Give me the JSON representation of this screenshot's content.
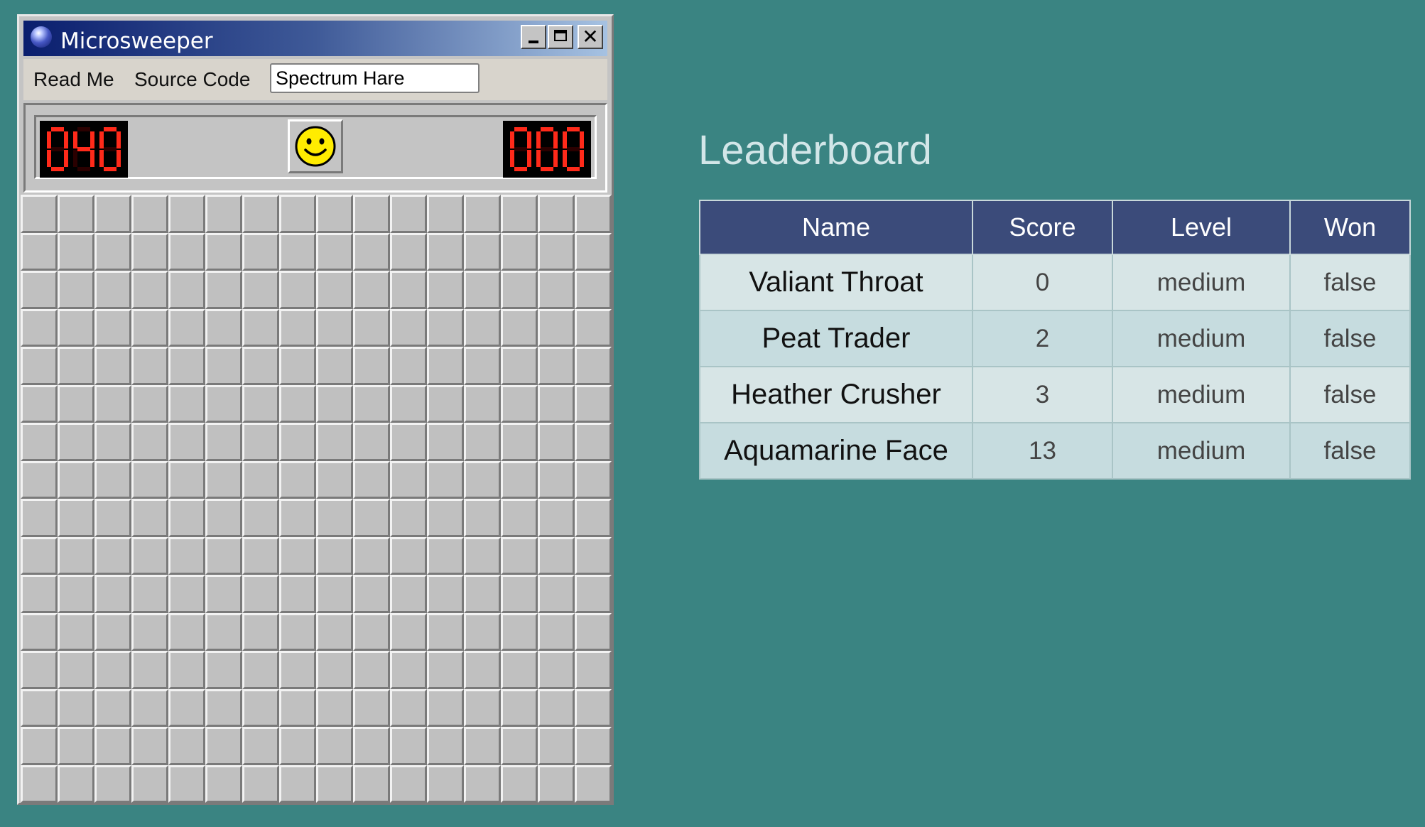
{
  "window": {
    "title": "Microsweeper",
    "controls": [
      "minimize",
      "maximize",
      "close"
    ]
  },
  "menu": {
    "read_me": "Read Me",
    "source_code": "Source Code",
    "player_name_value": "Spectrum Hare"
  },
  "game": {
    "mines_remaining": "040",
    "timer": "000",
    "face_state": "smile",
    "rows": 16,
    "cols": 16,
    "cell_state": "unrevealed"
  },
  "leaderboard": {
    "title": "Leaderboard",
    "columns": [
      "Name",
      "Score",
      "Level",
      "Won"
    ],
    "rows": [
      {
        "name": "Valiant Throat",
        "score": "0",
        "level": "medium",
        "won": "false"
      },
      {
        "name": "Peat Trader",
        "score": "2",
        "level": "medium",
        "won": "false"
      },
      {
        "name": "Heather Crusher",
        "score": "3",
        "level": "medium",
        "won": "false"
      },
      {
        "name": "Aquamarine Face",
        "score": "13",
        "level": "medium",
        "won": "false"
      }
    ]
  },
  "colors": {
    "background": "#3a8482",
    "lcd_digit": "#ff2a1a",
    "table_header": "#3b4b7a",
    "title_text": "#d2e6e8"
  }
}
